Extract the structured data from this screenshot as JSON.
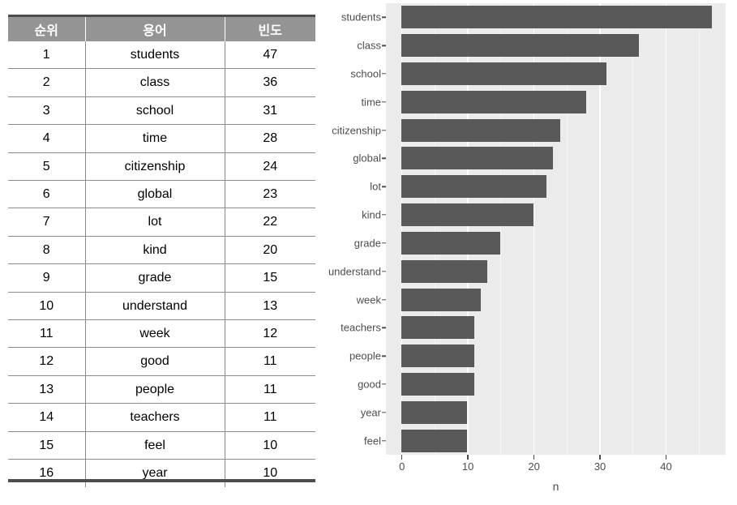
{
  "table": {
    "name": "term-frequency-table",
    "headers": [
      "순위",
      "용어",
      "빈도"
    ],
    "rows": [
      {
        "rank": "1",
        "term": "students",
        "freq": "47"
      },
      {
        "rank": "2",
        "term": "class",
        "freq": "36"
      },
      {
        "rank": "3",
        "term": "school",
        "freq": "31"
      },
      {
        "rank": "4",
        "term": "time",
        "freq": "28"
      },
      {
        "rank": "5",
        "term": "citizenship",
        "freq": "24"
      },
      {
        "rank": "6",
        "term": "global",
        "freq": "23"
      },
      {
        "rank": "7",
        "term": "lot",
        "freq": "22"
      },
      {
        "rank": "8",
        "term": "kind",
        "freq": "20"
      },
      {
        "rank": "9",
        "term": "grade",
        "freq": "15"
      },
      {
        "rank": "10",
        "term": "understand",
        "freq": "13"
      },
      {
        "rank": "11",
        "term": "week",
        "freq": "12"
      },
      {
        "rank": "12",
        "term": "good",
        "freq": "11"
      },
      {
        "rank": "13",
        "term": "people",
        "freq": "11"
      },
      {
        "rank": "14",
        "term": "teachers",
        "freq": "11"
      },
      {
        "rank": "15",
        "term": "feel",
        "freq": "10"
      },
      {
        "rank": "16",
        "term": "year",
        "freq": "10"
      }
    ]
  },
  "chart_data": {
    "type": "bar",
    "orientation": "horizontal",
    "title": "",
    "xlabel": "n",
    "ylabel": "",
    "xlim": [
      0,
      48
    ],
    "ylim": null,
    "grid": true,
    "legend": false,
    "xticks": [
      "0",
      "10",
      "20",
      "30",
      "40"
    ],
    "xtick_values": [
      0,
      10,
      20,
      30,
      40
    ],
    "xminor_values": [
      5,
      15,
      25,
      35,
      45
    ],
    "categories": [
      "students",
      "class",
      "school",
      "time",
      "citizenship",
      "global",
      "lot",
      "kind",
      "grade",
      "understand",
      "week",
      "teachers",
      "people",
      "good",
      "year",
      "feel"
    ],
    "values": [
      47,
      36,
      31,
      28,
      24,
      23,
      22,
      20,
      15,
      13,
      12,
      11,
      11,
      11,
      10,
      10
    ],
    "bar_color": "#595959",
    "panel_color": "#ebebeb",
    "grid_color": "#ffffff",
    "axis_text_color": "#4d4d4d"
  }
}
